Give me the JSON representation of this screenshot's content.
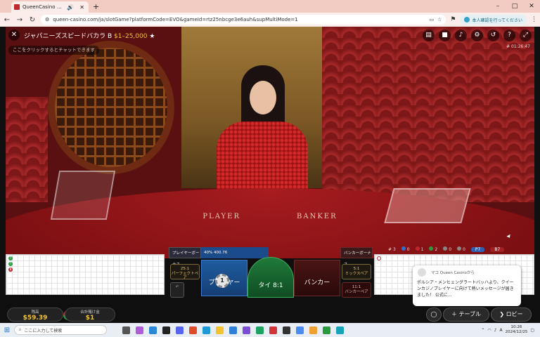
{
  "browser": {
    "tab_title": "QueenCasino クイーンカジノ |",
    "url": "queen-casino.com/ja/slotGame?platformCode=EVO&gameId=rtz25nbcge3e6auh&supMultiMode=1",
    "profile_label": "本人確認を行ってください",
    "new_tab": "+",
    "win_min": "–",
    "win_max": "□",
    "win_close": "✕"
  },
  "game": {
    "title": "ジャパニーズスピードバカラ B",
    "limits": "$1–25,000",
    "chat_placeholder": "ここをクリックするとチャットできます",
    "game_id": "# 01:26:47",
    "table_player": "PLAYER",
    "table_banker": "BANKER"
  },
  "stats": {
    "rounds": "3",
    "player": "0",
    "banker": "1",
    "tie": "2",
    "p_pair": "0",
    "b_pair": "0",
    "p7": "P7",
    "b7": "B7"
  },
  "bets": {
    "player_bonus": "プレイヤーボーナス",
    "perfect_pair_odds": "25:1",
    "perfect_pair": "パーフェクトペア",
    "player_stats": "400.76",
    "player_bet_pct": "40%",
    "player_label": "プレイヤー",
    "tie_label": "タイ 8:1",
    "tie_stats": "0",
    "banker_label": "バンカー",
    "banker_bonus": "バンカーボーナス",
    "mixed_pair_odds": "5:1",
    "mixed_pair": "ミックスペア",
    "banker_pair_odds": "11:1",
    "banker_pair": "バンカーペア",
    "chip_value": "1"
  },
  "bottom": {
    "balance_label": "残高",
    "balance": "$59.39",
    "total_bet_label": "合計賭け金",
    "total_bet": "$1",
    "table_btn": "テーブル",
    "lobby_btn": "ロビー"
  },
  "toast": {
    "from": "マコ Queen Casinoから",
    "message": "ポルシア・メンヒェングラートバッハより、クイーンカジノプレイヤーに向けて熱いメッセージが届きました！ 公式に..."
  },
  "taskbar": {
    "search_placeholder": "ここに入力して検索",
    "time": "10:26",
    "date": "2024/12/25",
    "lang": "A"
  }
}
